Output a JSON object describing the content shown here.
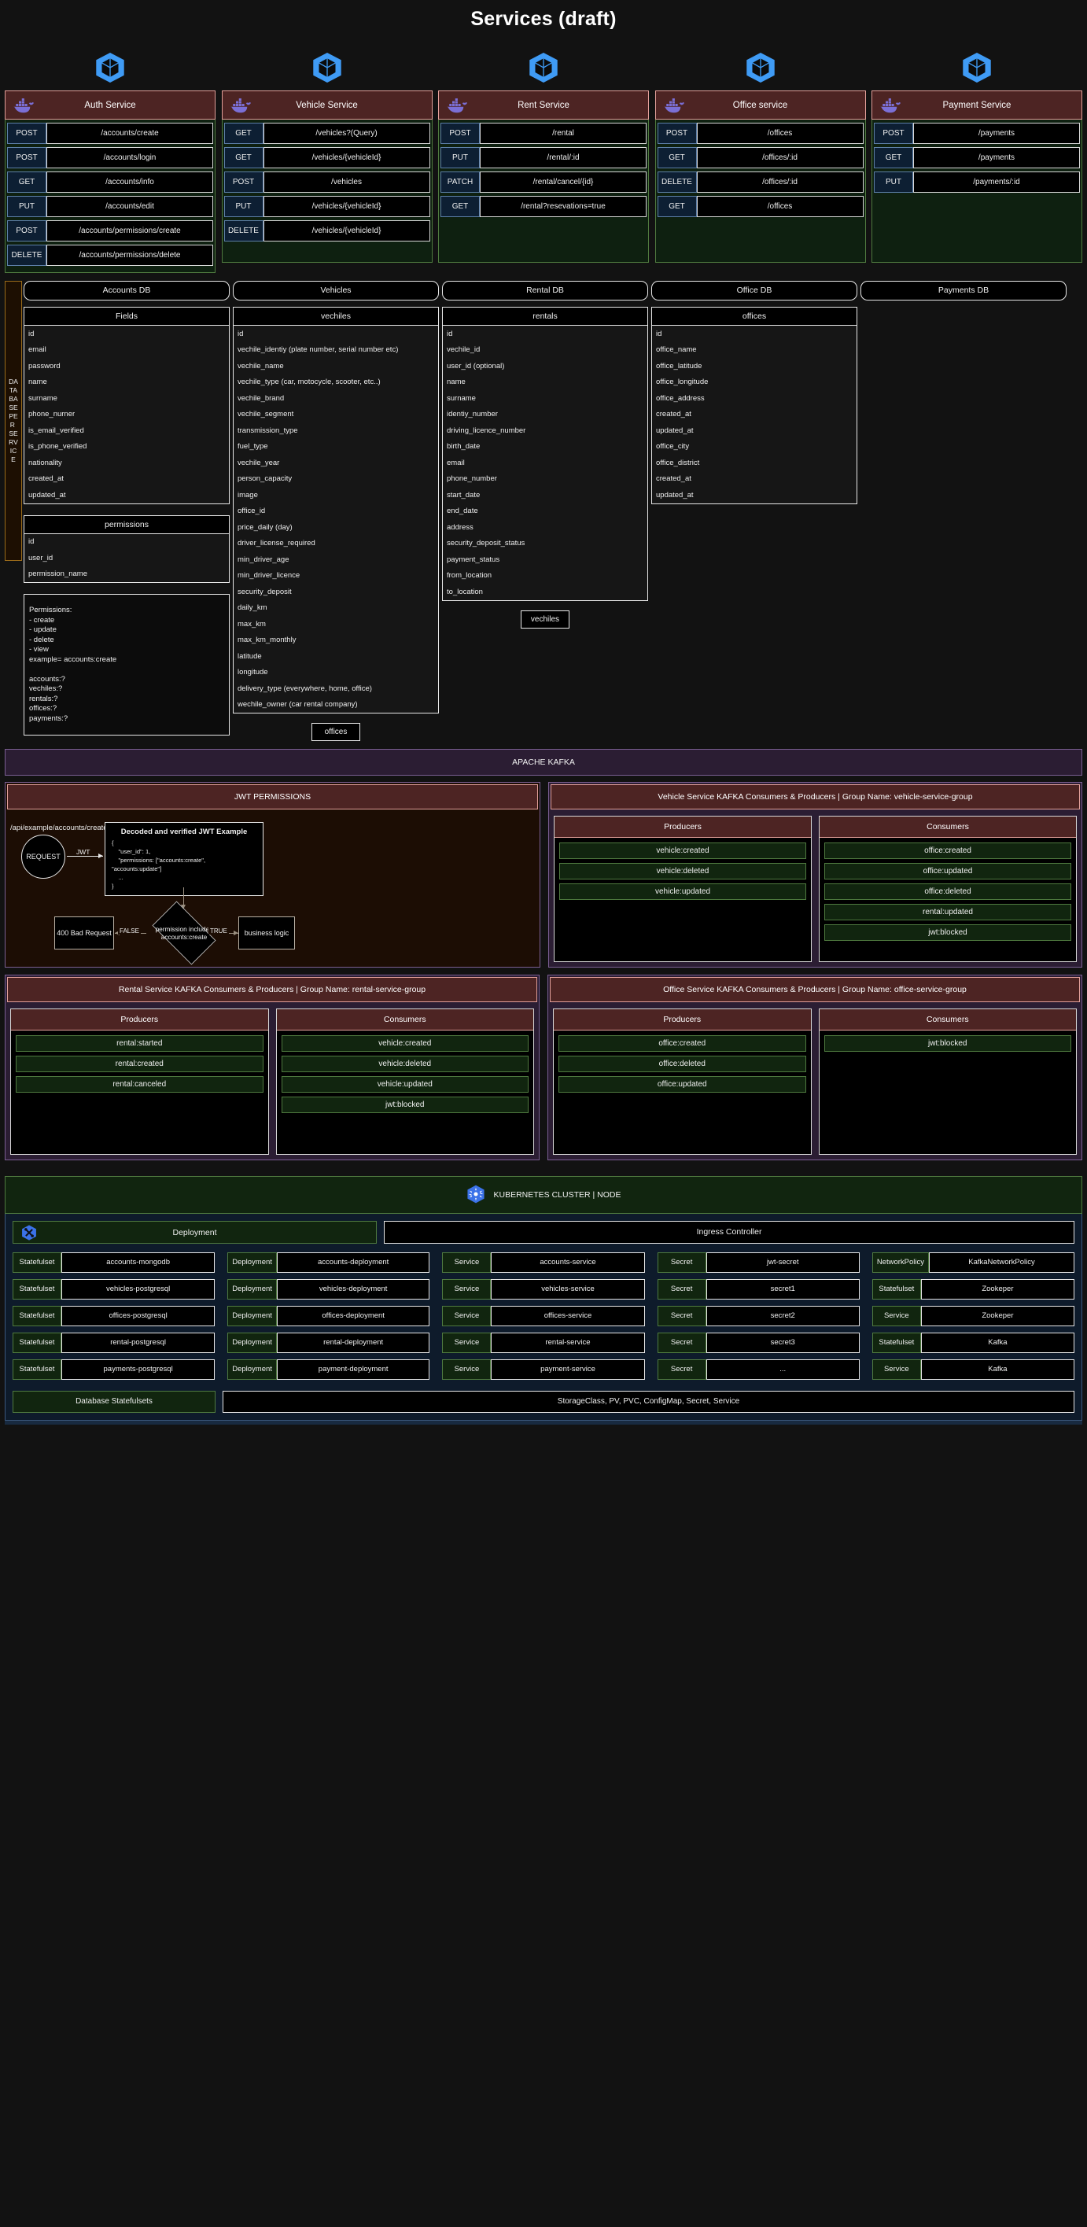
{
  "title": "Services (draft)",
  "icons": {
    "k8s": "kubernetes-logo-icon",
    "docker": "docker-whale-icon",
    "deployment": "k8s-deployment-icon"
  },
  "services": [
    {
      "name": "Auth Service",
      "endpoints": [
        {
          "verb": "POST",
          "path": "/accounts/create"
        },
        {
          "verb": "POST",
          "path": "/accounts/login"
        },
        {
          "verb": "GET",
          "path": "/accounts/info"
        },
        {
          "verb": "PUT",
          "path": "/accounts/edit"
        },
        {
          "verb": "POST",
          "path": "/accounts/permissions/create"
        },
        {
          "verb": "DELETE",
          "path": "/accounts/permissions/delete"
        }
      ]
    },
    {
      "name": "Vehicle Service",
      "endpoints": [
        {
          "verb": "GET",
          "path": "/vehicles?(Query)"
        },
        {
          "verb": "GET",
          "path": "/vehicles/{vehicleId}"
        },
        {
          "verb": "POST",
          "path": "/vehicles"
        },
        {
          "verb": "PUT",
          "path": "/vehicles/{vehicleId}"
        },
        {
          "verb": "DELETE",
          "path": "/vehicles/{vehicleId}"
        }
      ]
    },
    {
      "name": "Rent Service",
      "endpoints": [
        {
          "verb": "POST",
          "path": "/rental"
        },
        {
          "verb": "PUT",
          "path": "/rental/:id"
        },
        {
          "verb": "PATCH",
          "path": "/rental/cancel/{id}"
        },
        {
          "verb": "GET",
          "path": "/rental?resevations=true"
        }
      ]
    },
    {
      "name": "Office service",
      "endpoints": [
        {
          "verb": "POST",
          "path": "/offices"
        },
        {
          "verb": "GET",
          "path": "/offices/:id"
        },
        {
          "verb": "DELETE",
          "path": "/offices/:id"
        },
        {
          "verb": "GET",
          "path": "/offices"
        }
      ]
    },
    {
      "name": "Payment Service",
      "endpoints": [
        {
          "verb": "POST",
          "path": "/payments"
        },
        {
          "verb": "GET",
          "path": "/payments"
        },
        {
          "verb": "PUT",
          "path": "/payments/:id"
        }
      ]
    }
  ],
  "database_section": {
    "side_label": "DATABASE PER SERVICE",
    "columns": [
      {
        "db_name": "Accounts DB",
        "tables": [
          {
            "name": "Fields",
            "fields": [
              "id",
              "email",
              "password",
              "name",
              "surname",
              "phone_nurner",
              "is_email_verified",
              "is_phone_verified",
              "nationality",
              "created_at",
              "updated_at"
            ]
          },
          {
            "name": "permissions",
            "fields": [
              "id",
              "user_id",
              "permission_name"
            ]
          }
        ],
        "note": "Permissions:\n- create\n- update\n- delete\n- view\nexample= accounts:create\n\naccounts:?\nvechiles:?\nrentals:?\noffices:?\npayments:?",
        "mini": ""
      },
      {
        "db_name": "Vehicles",
        "tables": [
          {
            "name": "vechiles",
            "fields": [
              "id",
              "vechile_identiy (plate number, serial number etc)",
              "vechile_name",
              "vechile_type (car, motocycle, scooter, etc..)",
              "vechile_brand",
              "vechile_segment",
              "transmission_type",
              "fuel_type",
              "vechile_year",
              "person_capacity",
              "image",
              "office_id",
              "price_daily (day)",
              "driver_license_required",
              "min_driver_age",
              "min_driver_licence",
              "security_deposit",
              "daily_km",
              "max_km",
              "max_km_monthly",
              "latitude",
              "longitude",
              "delivery_type (everywhere, home, office)",
              "wechile_owner (car rental company)"
            ]
          }
        ],
        "note": "",
        "mini": "offices"
      },
      {
        "db_name": "Rental DB",
        "tables": [
          {
            "name": "rentals",
            "fields": [
              "id",
              "vechile_id",
              "user_id (optional)",
              "name",
              "surname",
              "identiy_number",
              "driving_licence_number",
              "birth_date",
              "email",
              "phone_number",
              "start_date",
              "end_date",
              "address",
              "security_deposit_status",
              "payment_status",
              "from_location",
              "to_location"
            ]
          }
        ],
        "note": "",
        "mini": "vechiles"
      },
      {
        "db_name": "Office DB",
        "tables": [
          {
            "name": "offices",
            "fields": [
              "id",
              "office_name",
              "office_latitude",
              "office_longitude",
              "office_address",
              "created_at",
              "updated_at",
              "office_city",
              "office_district",
              "created_at",
              "updated_at"
            ]
          }
        ],
        "note": "",
        "mini": ""
      },
      {
        "db_name": "Payments DB",
        "tables": [],
        "note": "",
        "mini": ""
      }
    ]
  },
  "kafka_bar": "APACHE KAFKA",
  "jwt_panel": {
    "header": "JWT PERMISSIONS",
    "url_label": "/api/example/accounts/create",
    "request_label": "REQUEST",
    "jwt_edge_label": "JWT",
    "code_title": "Decoded and verified JWT Example",
    "code_body": "{\n    \"user_id\": 1,\n    \"permissions: [\"accounts:create\", \"accounts:update\"]\n    ...\n}",
    "decision_label": "permission includes accounts:create",
    "false_label": "FALSE",
    "true_label": "TRUE",
    "bad_request_label": "400 Bad Request",
    "business_logic_label": "business logic"
  },
  "kafka_panels": [
    {
      "header": "Vehicle Service KAFKA Consumers & Producers | Group Name: vehicle-service-group",
      "producers_label": "Producers",
      "consumers_label": "Consumers",
      "producers": [
        "vehicle:created",
        "vehicle:deleted",
        "vehicle:updated"
      ],
      "consumers": [
        "office:created",
        "office:updated",
        "office:deleted",
        "rental:updated",
        "jwt:blocked"
      ]
    },
    {
      "header": "Rental Service KAFKA Consumers & Producers | Group Name: rental-service-group",
      "producers_label": "Producers",
      "consumers_label": "Consumers",
      "producers": [
        "rental:started",
        "rental:created",
        "rental:canceled"
      ],
      "consumers": [
        "vehicle:created",
        "vehicle:deleted",
        "vehicle:updated",
        "jwt:blocked"
      ]
    },
    {
      "header": "Office Service KAFKA Consumers & Producers | Group Name: office-service-group",
      "producers_label": "Producers",
      "consumers_label": "Consumers",
      "producers": [
        "office:created",
        "office:deleted",
        "office:updated"
      ],
      "consumers": [
        "jwt:blocked"
      ]
    }
  ],
  "kubernetes": {
    "header": "KUBERNETES CLUSTER | NODE",
    "deployment_label": "Deployment",
    "ingress_label": "Ingress Controller",
    "columns": [
      [
        {
          "kind": "Statefulset",
          "name": "accounts-mongodb"
        },
        {
          "kind": "Statefulset",
          "name": "vehicles-postgresql"
        },
        {
          "kind": "Statefulset",
          "name": "offices-postgresql"
        },
        {
          "kind": "Statefulset",
          "name": "rental-postgresql"
        },
        {
          "kind": "Statefulset",
          "name": "payments-postgresql"
        }
      ],
      [
        {
          "kind": "Deployment",
          "name": "accounts-deployment"
        },
        {
          "kind": "Deployment",
          "name": "vehicles-deployment"
        },
        {
          "kind": "Deployment",
          "name": "offices-deployment"
        },
        {
          "kind": "Deployment",
          "name": "rental-deployment"
        },
        {
          "kind": "Deployment",
          "name": "payment-deployment"
        }
      ],
      [
        {
          "kind": "Service",
          "name": "accounts-service"
        },
        {
          "kind": "Service",
          "name": "vehicles-service"
        },
        {
          "kind": "Service",
          "name": "offices-service"
        },
        {
          "kind": "Service",
          "name": "rental-service"
        },
        {
          "kind": "Service",
          "name": "payment-service"
        }
      ],
      [
        {
          "kind": "Secret",
          "name": "jwt-secret"
        },
        {
          "kind": "Secret",
          "name": "secret1"
        },
        {
          "kind": "Secret",
          "name": "secret2"
        },
        {
          "kind": "Secret",
          "name": "secret3"
        },
        {
          "kind": "Secret",
          "name": "..."
        }
      ],
      [
        {
          "kind": "NetworkPolicy",
          "name": "KafkaNetworkPolicy"
        },
        {
          "kind": "Statefulset",
          "name": "Zookeper"
        },
        {
          "kind": "Service",
          "name": "Zookeper"
        },
        {
          "kind": "Statefulset",
          "name": "Kafka"
        },
        {
          "kind": "Service",
          "name": "Kafka"
        }
      ]
    ],
    "footer_left": "Database Statefulsets",
    "footer_right": "StorageClass, PV, PVC, ConfigMap, Secret, Service"
  }
}
